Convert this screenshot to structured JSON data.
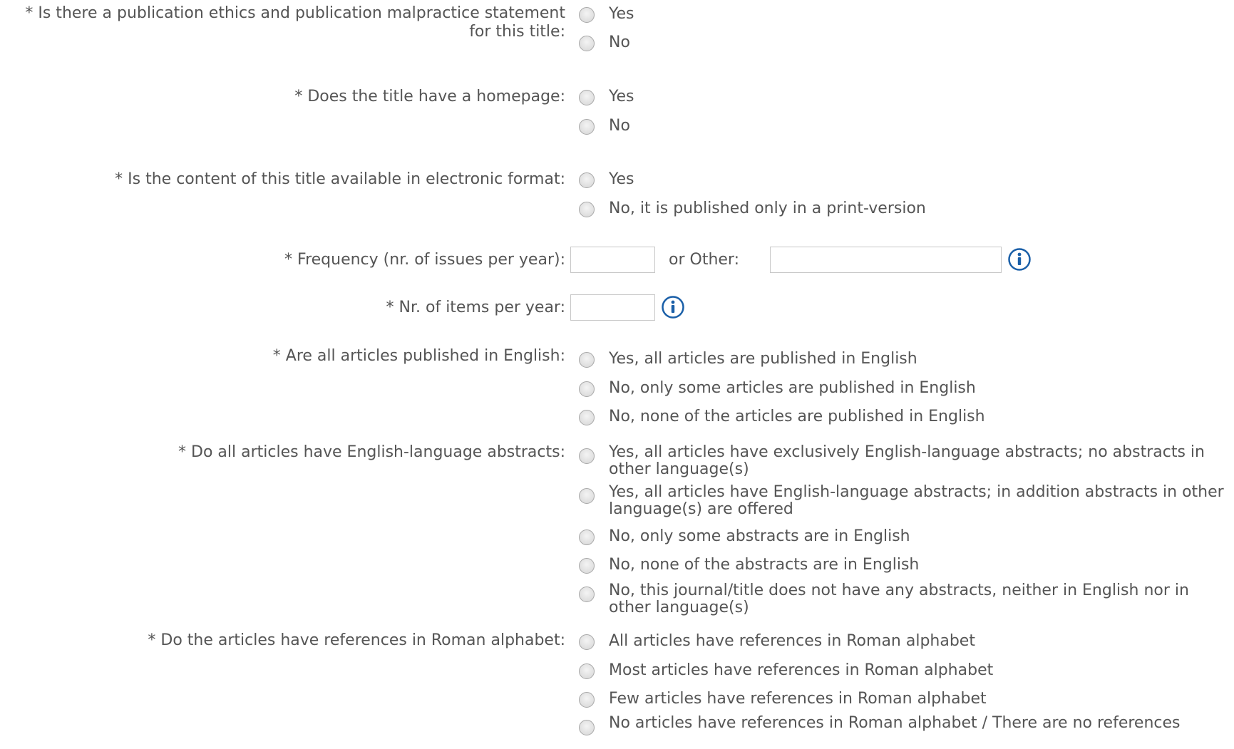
{
  "q_ethics": {
    "label": "* Is there a publication ethics and publication malpractice statement for this title:",
    "options": [
      "Yes",
      "No"
    ]
  },
  "q_homepage": {
    "label": "* Does the title have a homepage:",
    "options": [
      "Yes",
      "No"
    ]
  },
  "q_electronic": {
    "label": "* Is the content of this title available in electronic format:",
    "options": [
      "Yes",
      "No, it is published only in a print-version"
    ]
  },
  "q_frequency": {
    "label": "* Frequency (nr. of issues per year):",
    "value": "",
    "other_label": "or  Other:",
    "other_value": ""
  },
  "q_items": {
    "label": "* Nr. of items per year:",
    "value": ""
  },
  "q_english": {
    "label": "* Are all articles published in English:",
    "options": [
      "Yes, all articles are published in English",
      "No, only some articles are published in English",
      "No, none of the articles are published in English"
    ]
  },
  "q_abstracts": {
    "label": "* Do all articles have English-language abstracts:",
    "options": [
      "Yes, all articles have exclusively English-language abstracts; no abstracts in other language(s)",
      "Yes, all articles have English-language abstracts; in addition abstracts in other language(s) are offered",
      "No, only some abstracts are in English",
      "No, none of the abstracts are in English",
      "No, this journal/title does not have any abstracts, neither in English nor in other language(s)"
    ]
  },
  "q_references": {
    "label": "* Do the articles have references in Roman alphabet:",
    "options": [
      "All articles have references in Roman alphabet",
      "Most articles have references in Roman alphabet",
      "Few articles have references in Roman alphabet",
      "No articles have references in Roman alphabet / There are no references"
    ]
  },
  "icons": {
    "info": "info-icon",
    "info_color": "#1a5fa8"
  }
}
